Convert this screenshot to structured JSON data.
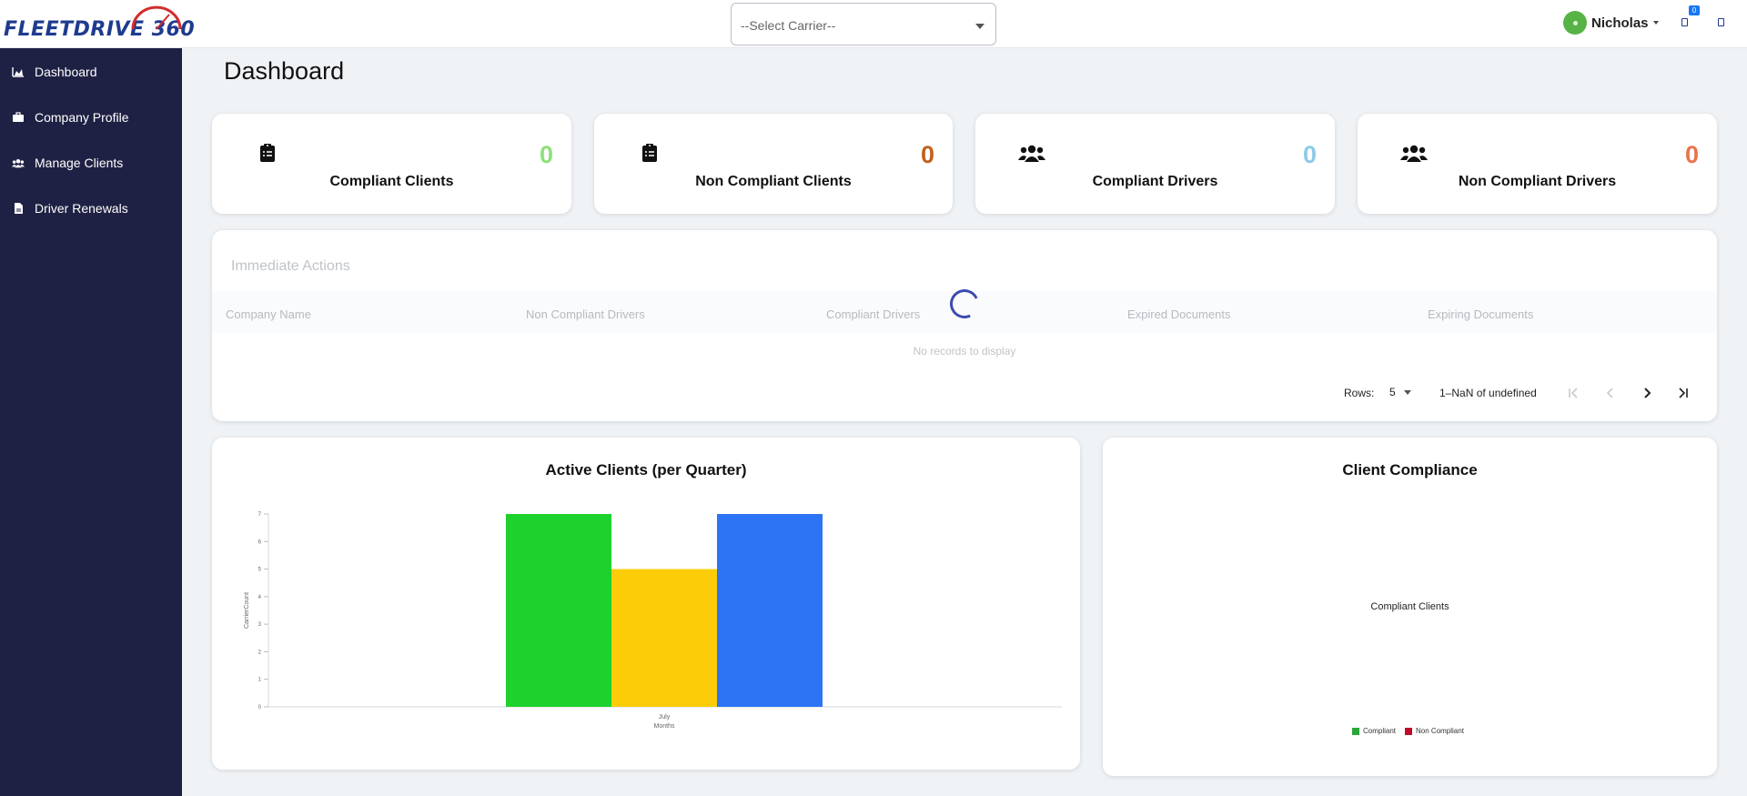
{
  "app": {
    "logo_text": "FLEETDRIVE 360"
  },
  "header": {
    "carrier_placeholder": "--Select Carrier--",
    "user_name": "Nicholas",
    "notification_count": "0"
  },
  "sidebar": {
    "items": [
      {
        "label": "Dashboard",
        "icon": "chart-area-icon"
      },
      {
        "label": "Company Profile",
        "icon": "briefcase-icon"
      },
      {
        "label": "Manage Clients",
        "icon": "users-icon"
      },
      {
        "label": "Driver Renewals",
        "icon": "file-icon"
      }
    ]
  },
  "page": {
    "title": "Dashboard"
  },
  "stats": [
    {
      "label": "Compliant Clients",
      "value": "0",
      "color": "#8ee07a",
      "icon": "clipboard-icon"
    },
    {
      "label": "Non Compliant Clients",
      "value": "0",
      "color": "#c0621f",
      "icon": "clipboard-icon"
    },
    {
      "label": "Compliant Drivers",
      "value": "0",
      "color": "#8ccbe8",
      "icon": "users-icon"
    },
    {
      "label": "Non Compliant Drivers",
      "value": "0",
      "color": "#e8744c",
      "icon": "users-icon"
    }
  ],
  "immediate_actions": {
    "title": "Immediate Actions",
    "columns": [
      "Company Name",
      "Non Compliant Drivers",
      "Compliant Drivers",
      "Expired Documents",
      "Expiring Documents"
    ],
    "empty_message": "No records to display",
    "rows_label": "Rows:",
    "rows_value": "5",
    "range_text": "1–NaN of undefined"
  },
  "charts": {
    "active_clients_title": "Active Clients (per Quarter)",
    "client_compliance_title": "Client Compliance"
  },
  "chart_data": [
    {
      "type": "bar",
      "title": "Active Clients (per Quarter)",
      "categories": [
        "July"
      ],
      "xlabel": "Months",
      "ylabel": "CarrierCount",
      "ylim": [
        0,
        7
      ],
      "yticks": [
        "0",
        "1",
        "2",
        "3",
        "4",
        "5",
        "6",
        "7"
      ],
      "series": [
        {
          "values": [
            7
          ],
          "color": "#1ed12d"
        },
        {
          "values": [
            5
          ],
          "color": "#fbcc07"
        },
        {
          "values": [
            7
          ],
          "color": "#2c74f4"
        }
      ]
    },
    {
      "type": "pie",
      "title": "Client Compliance",
      "center_label": "Compliant Clients",
      "legend": [
        {
          "name": "Compliant",
          "color": "#2aa63a"
        },
        {
          "name": "Non Compliant",
          "color": "#c00d2a"
        }
      ],
      "values": [
        0,
        0
      ],
      "legend_position": "bottom"
    }
  ]
}
